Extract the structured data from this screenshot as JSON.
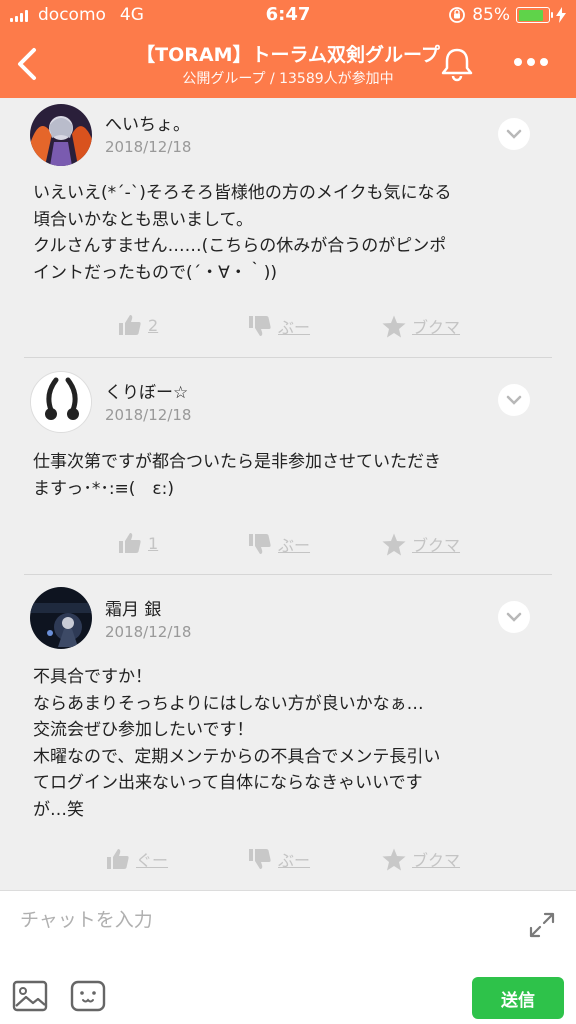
{
  "status_bar": {
    "carrier": "docomo",
    "network": "4G",
    "time": "6:47",
    "battery": "85%",
    "battery_level": 0.85
  },
  "header": {
    "title": "【TORAM】トーラム双剣グループ",
    "subtitle": "公開グループ / 13589人が参加中"
  },
  "posts": [
    {
      "user": "へいちょ。",
      "date": "2018/12/18",
      "lines": [
        "いえいえ(*´-`)そろそろ皆様他の方のメイクも気になる",
        "頃合いかなとも思いまして。",
        "クルさんすません……(こちらの休みが合うのがピンポ",
        "イントだったもので(´・∀・｀))"
      ],
      "like": "2",
      "boo": "ぶー",
      "bookmark": "ブクマ"
    },
    {
      "user": "くりぼー☆",
      "date": "2018/12/18",
      "lines": [
        "仕事次第ですが都合ついたら是非参加させていただき",
        "ますっ･*･:≡(　ε:)"
      ],
      "like": "1",
      "boo": "ぶー",
      "bookmark": "ブクマ"
    },
    {
      "user": "霜月 銀",
      "date": "2018/12/18",
      "lines": [
        "不具合ですか！",
        "ならあまりそっちよりにはしない方が良いかなぁ…",
        "交流会ぜひ参加したいです！",
        "木曜なので、定期メンテからの不具合でメンテ長引い",
        "てログイン出来ないって自体にならなきゃいいです",
        "が…笑"
      ],
      "like": "ぐー",
      "boo": "ぶー",
      "bookmark": "ブクマ"
    }
  ],
  "input": {
    "placeholder": "チャットを入力",
    "send_label": "送信"
  },
  "colors": {
    "accent": "#fd7b4a",
    "send": "#2ec24a"
  }
}
